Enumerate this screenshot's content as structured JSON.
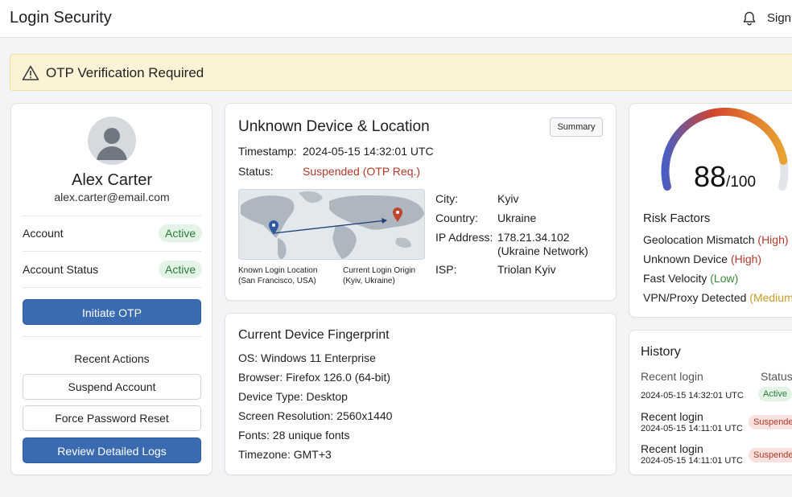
{
  "header": {
    "title": "Login Security",
    "sign_label": "Sign"
  },
  "alert": {
    "text": "OTP Verification Required"
  },
  "profile": {
    "name": "Alex Carter",
    "email": "alex.carter@email.com",
    "account_label": "Account",
    "account_value": "Active",
    "account_status_label": "Account Status",
    "account_status_value": "Active",
    "initiate_otp_label": "Initiate OTP",
    "recent_actions_title": "Recent Actions",
    "suspend_label": "Suspend Account",
    "force_reset_label": "Force Password Reset",
    "review_logs_label": "Review Detailed Logs"
  },
  "device": {
    "title": "Unknown Device & Location",
    "summary_label": "Summary",
    "timestamp_label": "Timestamp:",
    "timestamp_value": "2024-05-15 14:32:01 UTC",
    "status_label": "Status:",
    "status_value": "Suspended (OTP Req.)",
    "map_known_label": "Known Login Location",
    "map_known_place": "(San Francisco, USA)",
    "map_current_label": "Current Login Origin",
    "map_current_place": "(Kyiv, Ukraine)",
    "city_label": "City:",
    "city_value": "Kyiv",
    "country_label": "Country:",
    "country_value": "Ukraine",
    "ip_label": "IP Address:",
    "ip_value": "178.21.34.102",
    "ip_network": "(Ukraine Network)",
    "isp_label": "ISP:",
    "isp_value": "Triolan Kyiv"
  },
  "fingerprint": {
    "title": "Current Device Fingerprint",
    "os": "OS: Windows 11 Enterprise",
    "browser": "Browser: Firefox 126.0 (64-bit)",
    "device_type": "Device Type: Desktop",
    "resolution": "Screen Resolution: 2560x1440",
    "fonts": "Fonts: 28 unique fonts",
    "timezone": "Timezone: GMT+3"
  },
  "risk": {
    "score": "88",
    "score_max": "/100",
    "score_fraction": 0.88,
    "factors_title": "Risk Factors",
    "factors": [
      {
        "name": "Geolocation Mismatch",
        "severity": "(High)"
      },
      {
        "name": "Unknown Device",
        "severity": "(High)"
      },
      {
        "name": "Fast Velocity",
        "severity": "(Low)"
      },
      {
        "name": "VPN/Proxy Detected",
        "severity": "(Medium)"
      }
    ]
  },
  "history": {
    "title": "History",
    "col_event": "Recent login",
    "col_status": "Status",
    "rows": [
      {
        "event": "",
        "time": "2024-05-15 14:32:01 UTC",
        "status": "Active"
      },
      {
        "event": "Recent login",
        "time": "2024-05-15 14:11:01 UTC",
        "status": "Suspended"
      },
      {
        "event": "Recent login",
        "time": "2024-05-15 14:11:01 UTC",
        "status": "Suspended"
      }
    ]
  },
  "colors": {
    "primary": "#3a6bb0",
    "alert_bg": "#fcf3d6",
    "high": "#b13a2a",
    "low": "#3a8a3a",
    "medium": "#c99a2a"
  }
}
